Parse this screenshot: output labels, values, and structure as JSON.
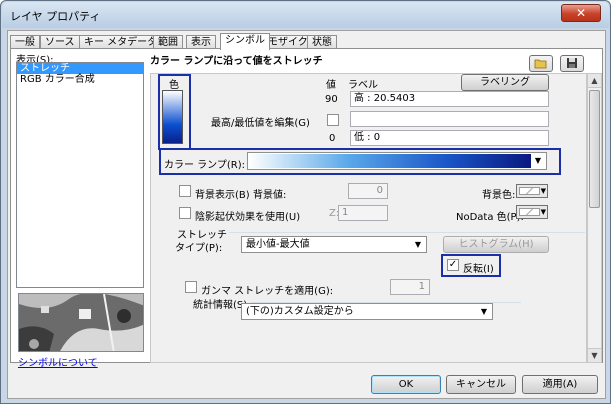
{
  "window": {
    "title": "レイヤ プロパティ",
    "close_label": "✕"
  },
  "tabs": [
    {
      "label": "一般"
    },
    {
      "label": "ソース"
    },
    {
      "label": "キー メタデータ"
    },
    {
      "label": "範囲"
    },
    {
      "label": "表示"
    },
    {
      "label": "シンボル"
    },
    {
      "label": "モザイク"
    },
    {
      "label": "状態"
    }
  ],
  "active_tab": "シンボル",
  "left": {
    "label": "表示(S):",
    "items": [
      {
        "label": "ストレッチ",
        "selected": true
      },
      {
        "label": "RGB カラー合成",
        "selected": false
      }
    ],
    "about_link": "シンボルについて"
  },
  "right": {
    "title": "カラー ランプに沿って値をストレッチ",
    "color_label": "色",
    "value_header": "値",
    "label_header": "ラベル",
    "labeling_button": "ラベリング",
    "high_value": "90",
    "high_label": "高 : 20.5403",
    "mid_label": "",
    "low_value": "0",
    "low_label": "低 : 0",
    "edit_highlow": "最高/最低値を編集(G)",
    "color_ramp_label": "カラー ランプ(R):",
    "background_label": "背景表示(B)",
    "background_value_label": "背景値:",
    "background_value": "0",
    "background_color_label": "背景色:",
    "hillshade_label": "陰影起伏効果を使用(U)",
    "z_label": "Z:",
    "z_value": "1",
    "nodata_label": "NoData 色(P):",
    "stretch_group": "ストレッチ",
    "type_label": "タイプ(P):",
    "type_value": "最小値-最大値",
    "histogram_button": "ヒストグラム(H)",
    "invert_label": "反転(I)",
    "invert_checked": true,
    "gamma_label": "ガンマ ストレッチを適用(G):",
    "gamma_value": "1",
    "stats_label": "統計情報(S)",
    "stats_value": "(下の)カスタム設定から"
  },
  "footer": {
    "ok": "OK",
    "cancel": "キャンセル",
    "apply": "適用(A)"
  },
  "colors": {
    "ramp_start": "#ffffff",
    "ramp_end": "#0a1880",
    "highlight": "#1a2fa8",
    "selection": "#3399ff"
  }
}
